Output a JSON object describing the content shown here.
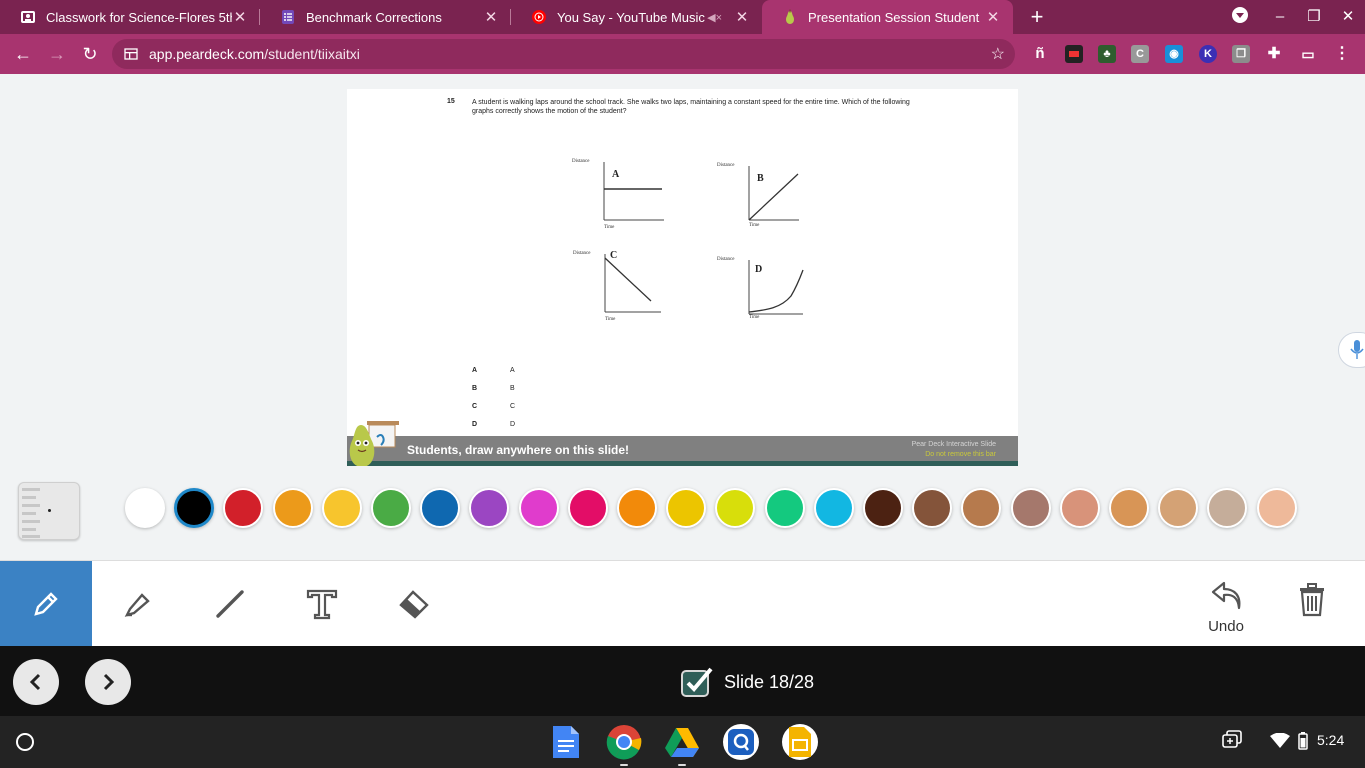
{
  "tabs": [
    {
      "title": "Classwork for Science-Flores 5th",
      "icon": "classroom-icon"
    },
    {
      "title": "Benchmark Corrections",
      "icon": "forms-icon"
    },
    {
      "title": "You Say - YouTube Music",
      "icon": "youtube-music-icon"
    },
    {
      "title": "Presentation Session Student",
      "icon": "peardeck-icon"
    }
  ],
  "address": {
    "host": "app.peardeck.com",
    "path": "/student/tiixaitxi"
  },
  "extensions": [
    "ñ",
    "",
    "",
    "C",
    "",
    "K",
    "",
    ""
  ],
  "question": {
    "number": "15",
    "text": "A student is walking laps around the school track.  She walks two laps, maintaining a constant speed for the entire time.  Which of the following graphs correctly shows the motion of the student?"
  },
  "graphs": [
    {
      "label": "A",
      "ylabel": "Distance",
      "xlabel": "Time",
      "shape": "flat"
    },
    {
      "label": "B",
      "ylabel": "Distance",
      "xlabel": "Time",
      "shape": "increasing-linear"
    },
    {
      "label": "C",
      "ylabel": "Distance",
      "xlabel": "Time",
      "shape": "decreasing-linear"
    },
    {
      "label": "D",
      "ylabel": "Distance",
      "xlabel": "Time",
      "shape": "curved-up"
    }
  ],
  "choices": [
    {
      "letter": "A",
      "text": "A"
    },
    {
      "letter": "B",
      "text": "B"
    },
    {
      "letter": "C",
      "text": "C"
    },
    {
      "letter": "D",
      "text": "D"
    }
  ],
  "banner": {
    "message": "Students, draw anywhere on this slide!",
    "brand_line1": "Pear Deck Interactive Slide",
    "brand_line2": "Do not remove this bar"
  },
  "palette": [
    "#ffffff",
    "#000000",
    "#d2202a",
    "#ec9a1a",
    "#f7c52d",
    "#4aab45",
    "#0f68b0",
    "#9b46c2",
    "#e03ccc",
    "#e30d67",
    "#f28a0a",
    "#ecc500",
    "#d8de0b",
    "#14c97f",
    "#12b7e2",
    "#4c2212",
    "#84543a",
    "#b67a4d",
    "#a5786c",
    "#d8937a",
    "#d89556",
    "#d4a275",
    "#c5ad9a",
    "#eeb99a",
    "#f5d5bd"
  ],
  "tools": {
    "items": [
      "pen-icon",
      "highlighter-icon",
      "line-icon",
      "text-icon",
      "eraser-icon"
    ],
    "undo_label": "Undo"
  },
  "slide_counter": "Slide 18/28",
  "clock": "5:24"
}
